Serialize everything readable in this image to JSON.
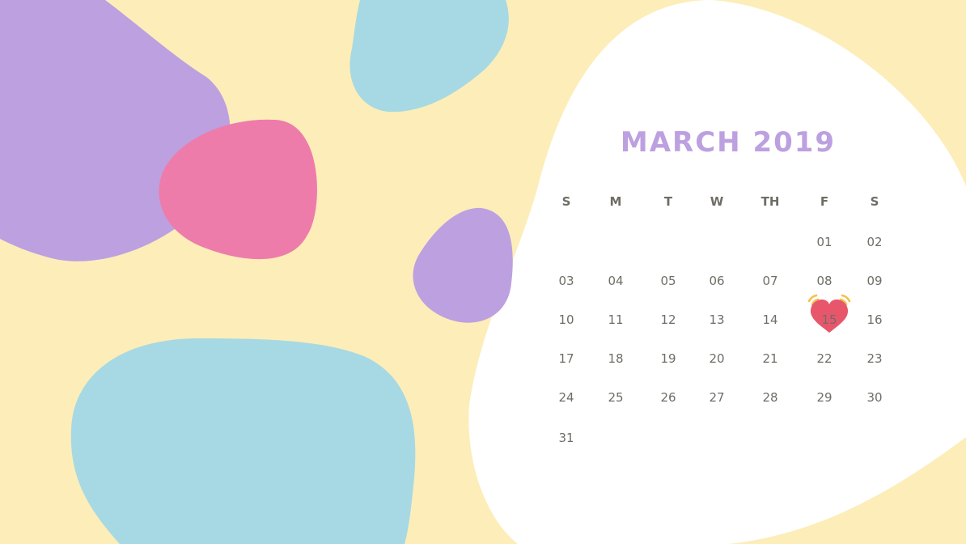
{
  "calendar": {
    "title": "MARCH 2019",
    "weekdays": [
      "S",
      "M",
      "T",
      "W",
      "TH",
      "F",
      "S"
    ],
    "weeks": [
      [
        "",
        "",
        "",
        "",
        "",
        "01",
        "02"
      ],
      [
        "03",
        "04",
        "05",
        "06",
        "07",
        "08",
        "09"
      ],
      [
        "10",
        "11",
        "12",
        "13",
        "14",
        "15",
        "16"
      ],
      [
        "17",
        "18",
        "19",
        "20",
        "21",
        "22",
        "23"
      ],
      [
        "24",
        "25",
        "26",
        "27",
        "28",
        "29",
        "30"
      ],
      [
        "31",
        "",
        "",
        "",
        "",
        "",
        ""
      ]
    ],
    "highlighted_day": "15",
    "highlight_icon": "heart-icon"
  },
  "colors": {
    "background": "#FDEDB9",
    "panel": "#FFFFFF",
    "purple": "#BDA0E0",
    "pink": "#EE7CAB",
    "blue": "#A6D9E3",
    "heart": "#E8566C",
    "heart_rays": "#F3C04D",
    "text": "#6f6d66"
  }
}
